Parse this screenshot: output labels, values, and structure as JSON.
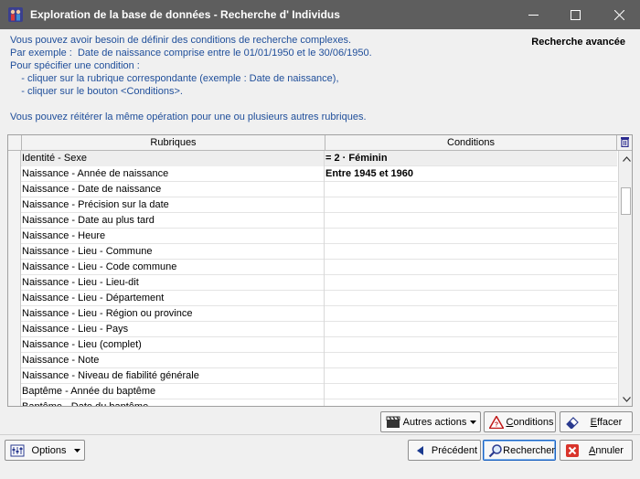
{
  "window": {
    "title": "Exploration de la base de données - Recherche d' Individus",
    "icons": {
      "app": "people-database-icon",
      "minimize": "minimize-icon",
      "maximize": "maximize-icon",
      "close": "close-icon"
    }
  },
  "intro": {
    "lines": [
      "Vous pouvez avoir besoin de définir des conditions de recherche complexes.",
      "Par exemple :  Date de naissance comprise entre le 01/01/1950 et le 30/06/1950.",
      "Pour spécifier une condition :",
      "    - cliquer sur la rubrique correspondante (exemple : Date de naissance),",
      "    - cliquer sur le bouton <Conditions>.",
      "Vous pouvez réitérer la même opération pour une ou plusieurs autres rubriques."
    ],
    "color": "#1f4e9a"
  },
  "mode_label": "Recherche avancée",
  "grid": {
    "columns": [
      "Rubriques",
      "Conditions"
    ],
    "header_icon": "trash-icon",
    "rows": [
      {
        "rubrique": "Identité - Sexe",
        "condition": "= 2 · Féminin"
      },
      {
        "rubrique": "Naissance - Année de naissance",
        "condition": "Entre 1945 et 1960"
      },
      {
        "rubrique": "Naissance - Date de naissance",
        "condition": ""
      },
      {
        "rubrique": "Naissance - Précision sur la date",
        "condition": ""
      },
      {
        "rubrique": "Naissance - Date au plus tard",
        "condition": ""
      },
      {
        "rubrique": "Naissance - Heure",
        "condition": ""
      },
      {
        "rubrique": "Naissance - Lieu - Commune",
        "condition": ""
      },
      {
        "rubrique": "Naissance - Lieu - Code commune",
        "condition": ""
      },
      {
        "rubrique": "Naissance - Lieu - Lieu-dit",
        "condition": ""
      },
      {
        "rubrique": "Naissance - Lieu - Département",
        "condition": ""
      },
      {
        "rubrique": "Naissance - Lieu - Région ou province",
        "condition": ""
      },
      {
        "rubrique": "Naissance - Lieu - Pays",
        "condition": ""
      },
      {
        "rubrique": "Naissance - Lieu (complet)",
        "condition": ""
      },
      {
        "rubrique": "Naissance - Note",
        "condition": ""
      },
      {
        "rubrique": "Naissance - Niveau de fiabilité générale",
        "condition": ""
      },
      {
        "rubrique": "Baptême - Année du baptême",
        "condition": ""
      },
      {
        "rubrique": "Baptême - Date du baptême",
        "condition": ""
      }
    ]
  },
  "actions": {
    "autres_actions": {
      "label": "Autres actions",
      "icon": "clapperboard-icon"
    },
    "conditions": {
      "label": "Conditions",
      "icon": "warning-triangle-icon"
    },
    "effacer": {
      "label": "Effacer",
      "icon": "eraser-icon"
    }
  },
  "footer": {
    "options": {
      "label": "Options",
      "icon": "sliders-icon"
    },
    "precedent": {
      "label": "Précédent",
      "icon": "back-arrow-icon"
    },
    "rechercher": {
      "label": "Rechercher",
      "icon": "magnifier-icon"
    },
    "annuler": {
      "label": "Annuler",
      "icon": "cancel-icon"
    }
  },
  "colors": {
    "titlebar": "#5e5e5e",
    "accent": "#1a62c0",
    "cancel": "#d9342b"
  }
}
